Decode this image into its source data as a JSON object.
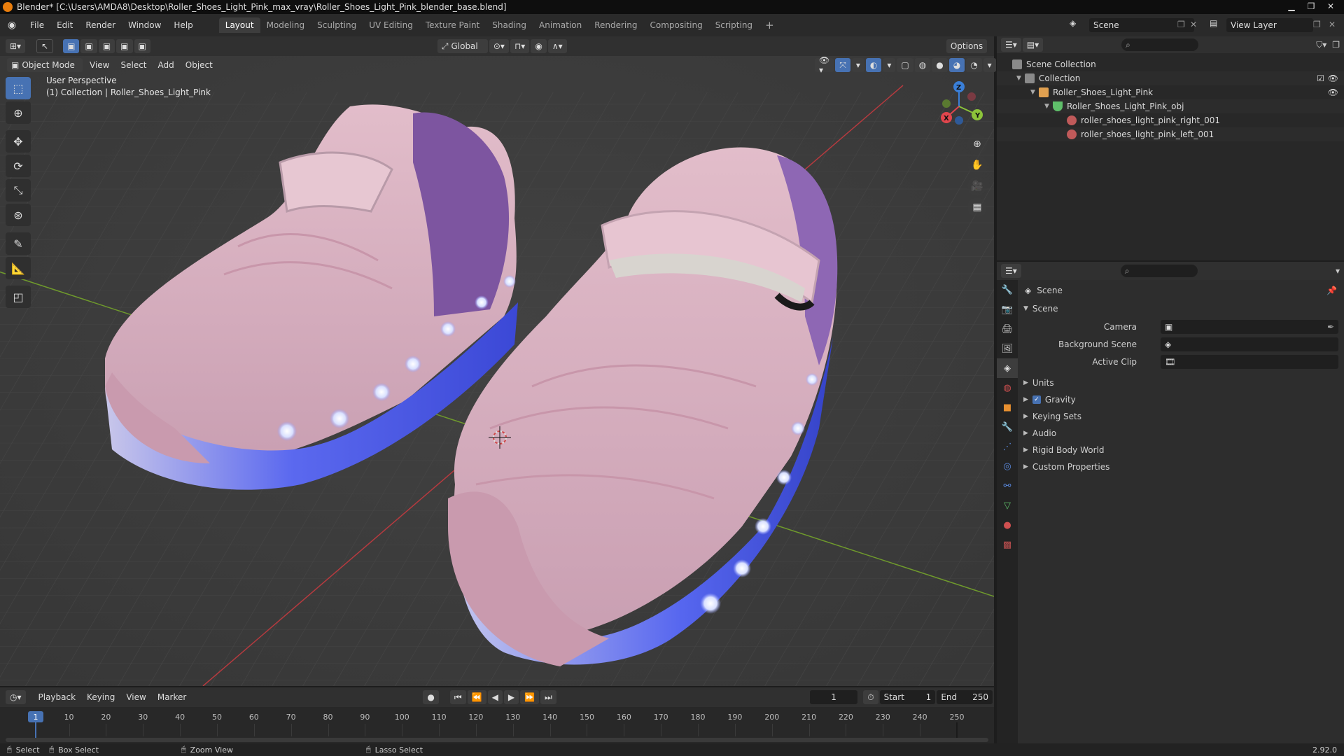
{
  "window": {
    "title": "Blender* [C:\\Users\\AMDA8\\Desktop\\Roller_Shoes_Light_Pink_max_vray\\Roller_Shoes_Light_Pink_blender_base.blend]"
  },
  "menu": [
    "File",
    "Edit",
    "Render",
    "Window",
    "Help"
  ],
  "workspaces": [
    "Layout",
    "Modeling",
    "Sculpting",
    "UV Editing",
    "Texture Paint",
    "Shading",
    "Animation",
    "Rendering",
    "Compositing",
    "Scripting"
  ],
  "top_right": {
    "scene": "Scene",
    "view_layer": "View Layer"
  },
  "viewport": {
    "transform_orientation": "Global",
    "options_label": "Options",
    "mode": "Object Mode",
    "menus": [
      "View",
      "Select",
      "Add",
      "Object"
    ],
    "overlay_line1": "User Perspective",
    "overlay_line2": "(1) Collection | Roller_Shoes_Light_Pink",
    "gizmo": {
      "x": "X",
      "y": "Y",
      "z": "Z"
    }
  },
  "outliner": {
    "rows": [
      {
        "label": "Scene Collection",
        "depth": 0,
        "icon": "scene-collection-icon"
      },
      {
        "label": "Collection",
        "depth": 1,
        "icon": "collection-icon"
      },
      {
        "label": "Roller_Shoes_Light_Pink",
        "depth": 2,
        "icon": "empty-object-icon"
      },
      {
        "label": "Roller_Shoes_Light_Pink_obj",
        "depth": 3,
        "icon": "mesh-data-icon"
      },
      {
        "label": "roller_shoes_light_pink_right_001",
        "depth": 4,
        "icon": "material-icon"
      },
      {
        "label": "roller_shoes_light_pink_left_001",
        "depth": 4,
        "icon": "material-icon"
      }
    ]
  },
  "properties": {
    "context": "Scene",
    "panel_title": "Scene",
    "fields": [
      {
        "label": "Camera",
        "value": ""
      },
      {
        "label": "Background Scene",
        "value": ""
      },
      {
        "label": "Active Clip",
        "value": ""
      }
    ],
    "subpanels": [
      "Units",
      "Gravity",
      "Keying Sets",
      "Audio",
      "Rigid Body World",
      "Custom Properties"
    ]
  },
  "timeline": {
    "menus": [
      "Playback",
      "Keying",
      "View",
      "Marker"
    ],
    "current_frame": "1",
    "start_label": "Start",
    "start": "1",
    "end_label": "End",
    "end": "250",
    "ticks": [
      1,
      10,
      20,
      30,
      40,
      50,
      60,
      70,
      80,
      90,
      100,
      110,
      120,
      130,
      140,
      150,
      160,
      170,
      180,
      190,
      200,
      210,
      220,
      230,
      240,
      250
    ]
  },
  "status": {
    "select": "Select",
    "box_select": "Box Select",
    "zoom_view": "Zoom View",
    "lasso_select": "Lasso Select",
    "version": "2.92.0"
  },
  "colors": {
    "accent": "#4772b3",
    "shoe_pink": "#d9b0c0",
    "sole_blue": "#5a6ef0",
    "x_axis": "#e0464d",
    "y_axis": "#8cc43a",
    "z_axis": "#3a7fd8"
  }
}
